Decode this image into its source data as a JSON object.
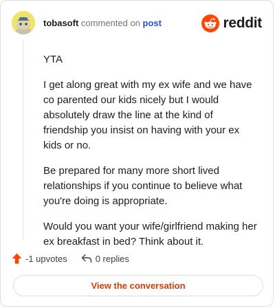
{
  "header": {
    "username": "tobasoft",
    "commented_text": "commented on",
    "post_link": "post"
  },
  "logo": {
    "icon": "reddit-snoo-icon",
    "text": "reddit",
    "brand_color": "#ff4500"
  },
  "comment": {
    "paragraphs": [
      "YTA",
      "I get along great with my ex wife and we have co parented our kids nicely but I would absolutely draw the line at the kind of friendship you insist on having with your ex kids or no.",
      "Be prepared for many more short lived relationships if you continue to believe what you're doing is appropriate.",
      "Would you want your wife/girlfriend making her ex breakfast in bed? Think about it."
    ]
  },
  "actions": {
    "upvotes_label": "-1 upvotes",
    "upvote_icon": "upvote-arrow-icon",
    "upvote_color": "#ff4500",
    "replies_label": "0 replies",
    "reply_icon": "reply-arrow-icon"
  },
  "cta": {
    "label": "View the conversation",
    "color": "#d93a00"
  }
}
